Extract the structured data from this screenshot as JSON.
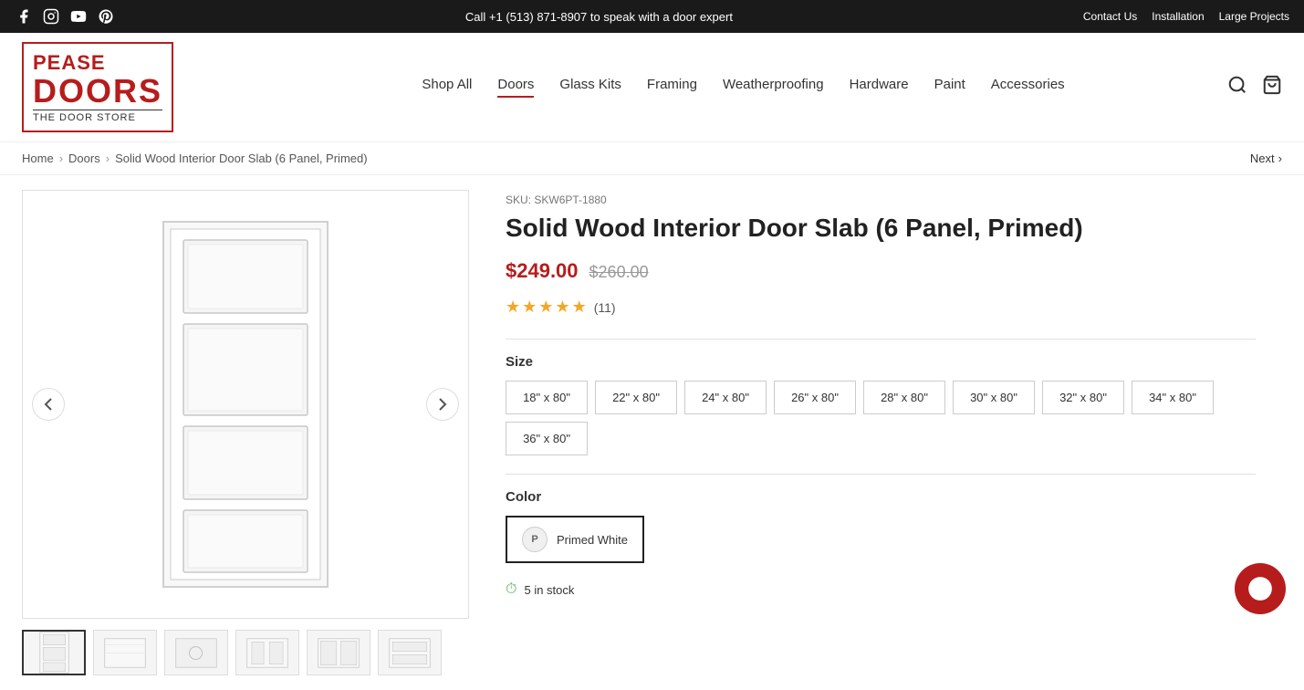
{
  "topbar": {
    "phone_text": "Call +1 (513) 871-8907 to speak with a door expert",
    "contact_label": "Contact Us",
    "installation_label": "Installation",
    "large_projects_label": "Large Projects"
  },
  "header": {
    "logo": {
      "line1": "PEASE",
      "line2": "DOORS",
      "line3": "The Door Store"
    },
    "nav": [
      {
        "label": "Shop All",
        "id": "shop-all"
      },
      {
        "label": "Doors",
        "id": "doors"
      },
      {
        "label": "Glass Kits",
        "id": "glass-kits"
      },
      {
        "label": "Framing",
        "id": "framing"
      },
      {
        "label": "Weatherproofing",
        "id": "weatherproofing"
      },
      {
        "label": "Hardware",
        "id": "hardware"
      },
      {
        "label": "Paint",
        "id": "paint"
      },
      {
        "label": "Accessories",
        "id": "accessories"
      }
    ]
  },
  "breadcrumb": {
    "home": "Home",
    "doors": "Doors",
    "current": "Solid Wood Interior Door Slab (6 Panel, Primed)",
    "next_label": "Next"
  },
  "product": {
    "sku_label": "SKU:",
    "sku_value": "SKW6PT-1880",
    "title": "Solid Wood Interior Door Slab (6 Panel, Primed)",
    "price_sale": "$249.00",
    "price_original": "$260.00",
    "rating_count": "(11)",
    "size_label": "Size",
    "sizes": [
      {
        "label": "18\" x 80\"",
        "selected": false
      },
      {
        "label": "22\" x 80\"",
        "selected": false
      },
      {
        "label": "24\" x 80\"",
        "selected": false
      },
      {
        "label": "26\" x 80\"",
        "selected": false
      },
      {
        "label": "28\" x 80\"",
        "selected": false
      },
      {
        "label": "30\" x 80\"",
        "selected": false
      },
      {
        "label": "32\" x 80\"",
        "selected": false
      },
      {
        "label": "34\" x 80\"",
        "selected": false
      },
      {
        "label": "36\" x 80\"",
        "selected": false
      }
    ],
    "color_label": "Color",
    "colors": [
      {
        "label": "Primed White",
        "swatch_letter": "P",
        "selected": true
      }
    ],
    "stock_text": "5 in stock"
  }
}
